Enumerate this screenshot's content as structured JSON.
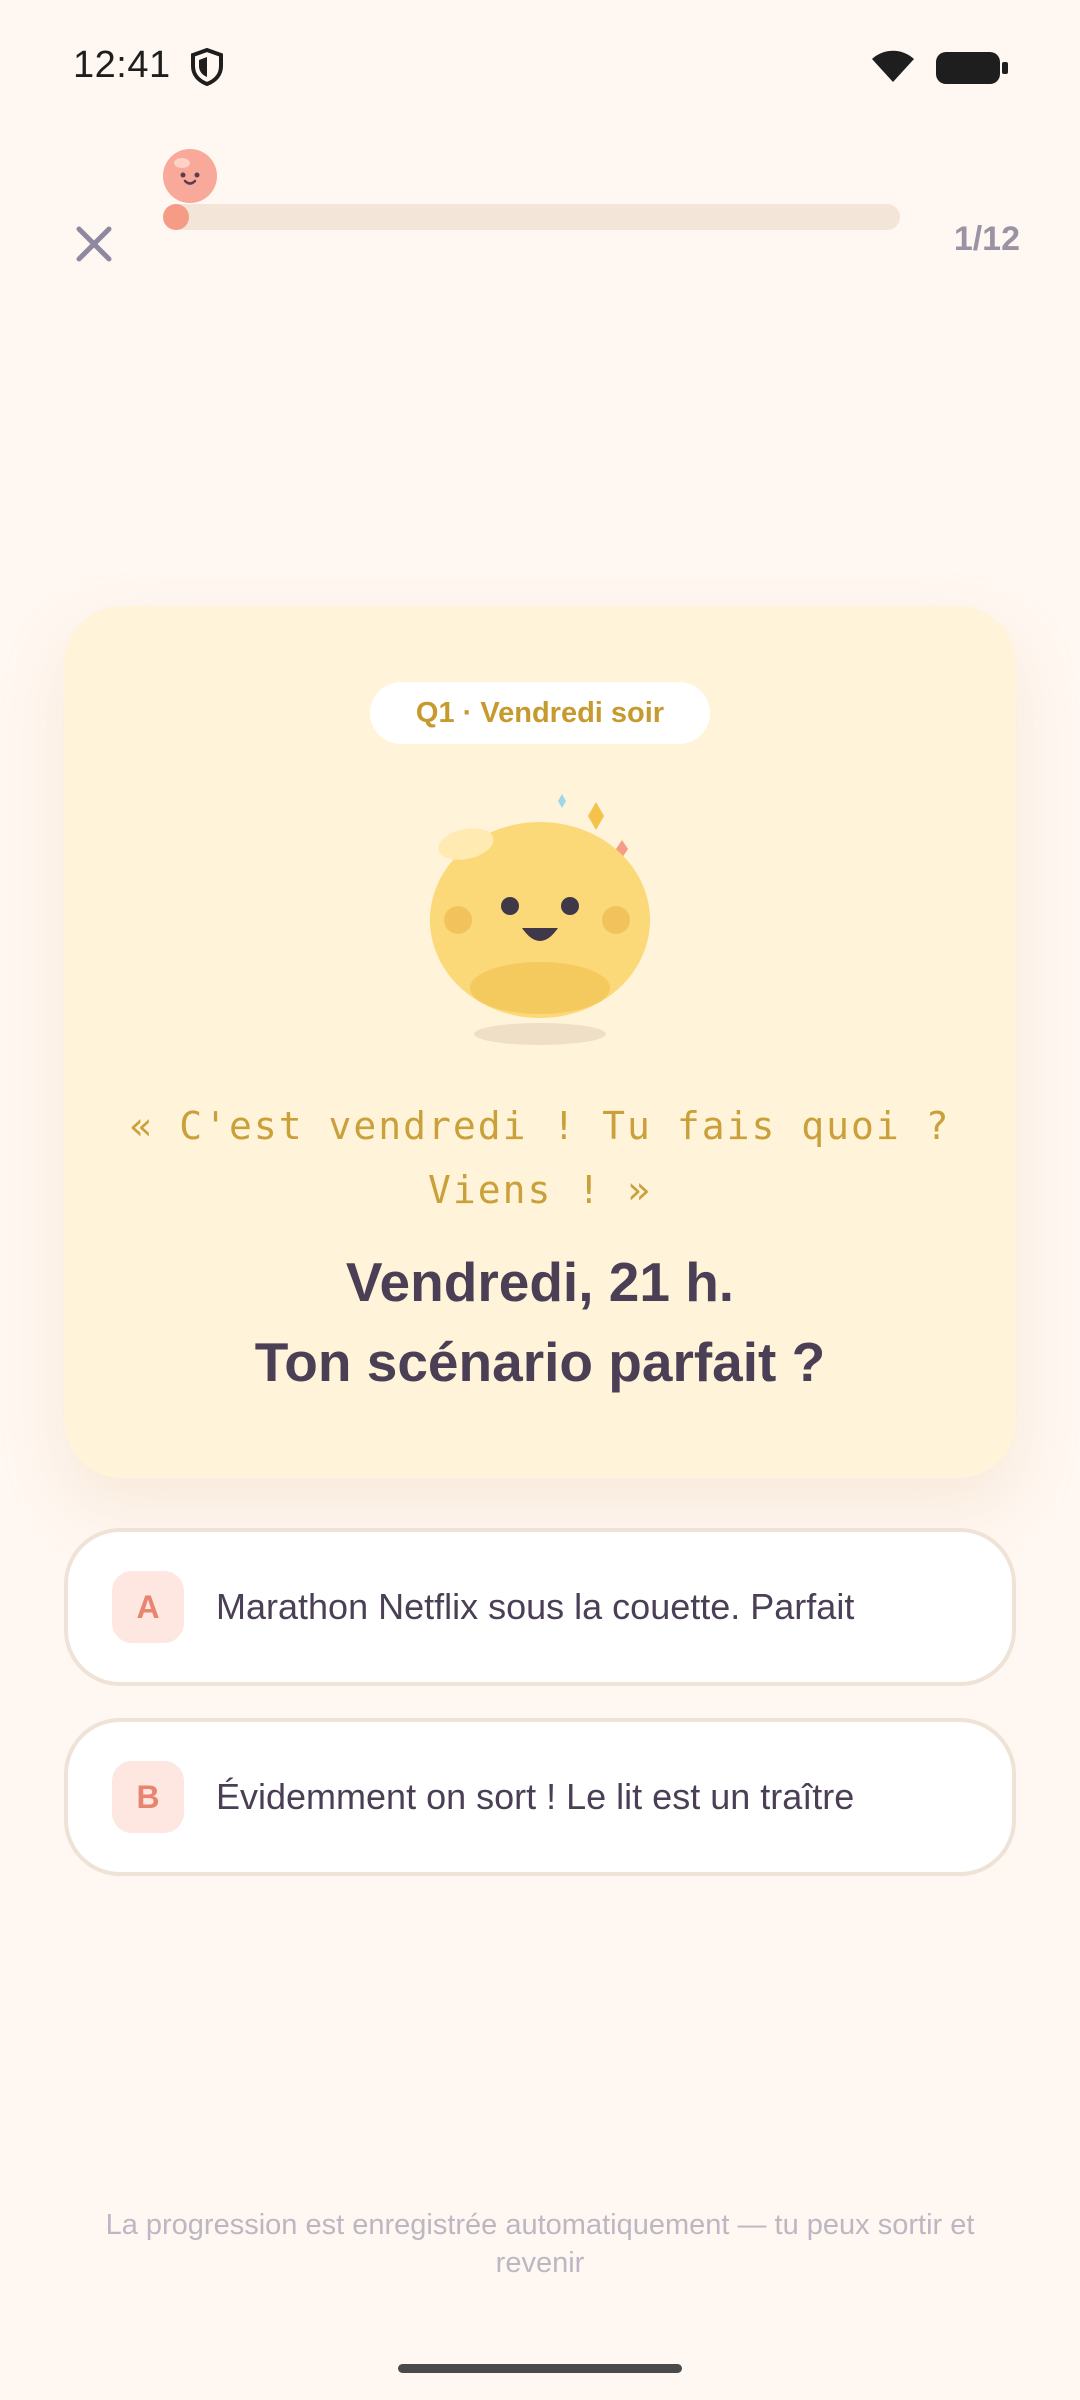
{
  "status_bar": {
    "time": "12:41",
    "icons": [
      "shield-icon",
      "wifi-icon",
      "battery-icon"
    ]
  },
  "top_bar": {
    "close_icon": "close-icon",
    "progress_fraction": 0.02,
    "counter": "1/12"
  },
  "card": {
    "tag": "Q1 · Vendredi soir",
    "mascot_icon": "happy-blob-mascot",
    "quote": "« C'est vendredi ! Tu fais quoi ? Viens ! »",
    "question_line1": "Vendredi, 21 h.",
    "question_line2": "Ton scénario parfait ?"
  },
  "answers": [
    {
      "letter": "A",
      "text": "Marathon Netflix sous la couette. Parfait"
    },
    {
      "letter": "B",
      "text": "Évidemment on sort ! Le lit est un traître"
    }
  ],
  "footer": {
    "note": "La progression est enregistrée automatiquement — tu peux sortir et revenir"
  },
  "colors": {
    "background": "#FFF7F1",
    "card": "#FFF4D9",
    "accent": "#F59B86",
    "gold": "#C69A2E",
    "text": "#4A3F55"
  }
}
